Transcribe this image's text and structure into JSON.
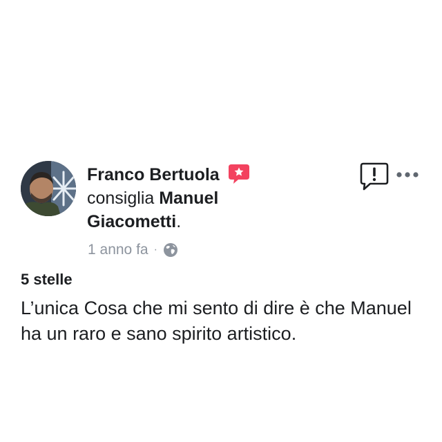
{
  "post": {
    "author": "Franco Bertuola",
    "verb": "consiglia",
    "page_name": "Manuel Giacometti",
    "period": ".",
    "timestamp": "1 anno fa",
    "separator": "·",
    "privacy_icon": "globe-icon",
    "badge_icon": "recommendation-star-icon",
    "rating_label": "5 stelle",
    "review_text": "L’unica Cosa che mi sento di dire è che Manuel ha un raro e sano spirito artistico."
  },
  "actions": {
    "report_icon": "report-icon",
    "more_icon": "more-options-icon"
  },
  "colors": {
    "text": "#1c1e21",
    "meta": "#8d949e",
    "badge": "#f3425f"
  }
}
